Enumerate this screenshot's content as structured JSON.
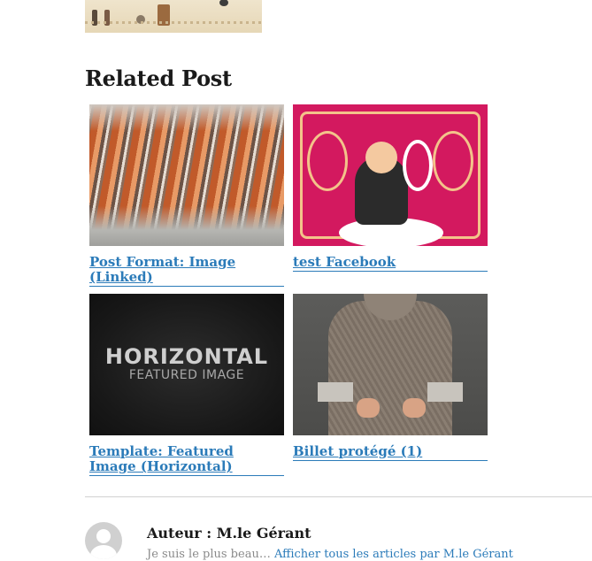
{
  "related": {
    "heading": "Related Post",
    "posts": [
      {
        "title": "Post Format: Image (Linked)",
        "image": "roasted-meat-photo"
      },
      {
        "title": "test Facebook",
        "image": "pink-illustration-gentleman"
      },
      {
        "title": "Template: Featured Image (Horizontal)",
        "image": "horizontal-featured-image",
        "image_text": "HORIZONTAL",
        "image_subtext": "FEATURED IMAGE"
      },
      {
        "title": "Billet protégé (1)",
        "image": "grey-sweater-photo"
      }
    ]
  },
  "author": {
    "heading": "Auteur : M.le Gérant",
    "bio": "Je suis le plus beau… ",
    "link": "Afficher tous les articles par M.le Gérant"
  },
  "colors": {
    "link": "#2b7bb9",
    "divider": "#d1d1d1"
  }
}
